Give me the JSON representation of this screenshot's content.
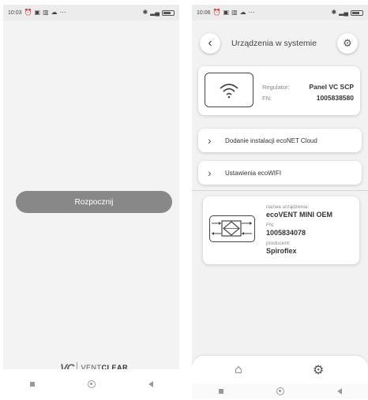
{
  "left_screen": {
    "status": {
      "time": "10:03",
      "right_icons": "✱ …"
    },
    "start_button_label": "Rozpocznij",
    "brand": {
      "mark": "VC",
      "text_a": "VENT",
      "text_b": "CLEAR"
    }
  },
  "right_screen": {
    "status": {
      "time": "10:06"
    },
    "header": {
      "title": "Urządzenia w systemie"
    },
    "regulator": {
      "regulator_label": "Regulator:",
      "regulator_value": "Panel VC SCP",
      "fn_label": "FN:",
      "fn_value": "1005838580"
    },
    "menu_items": [
      {
        "label": "Dodanie instalacji ecoNET Cloud"
      },
      {
        "label": "Ustawienia ecoWIFI"
      }
    ],
    "device": {
      "name_label": "nazwa urządzenia:",
      "name_value": "ecoVENT MINI OEM",
      "fn_label": "FN:",
      "fn_value": "1005834078",
      "producer_label": "producent:",
      "producer_value": "Spiroflex"
    }
  },
  "icons": {
    "back": "chevron-left-icon",
    "settings": "gear-icon",
    "wifi": "wifi-icon",
    "home": "home-icon",
    "device": "recuperator-icon"
  }
}
